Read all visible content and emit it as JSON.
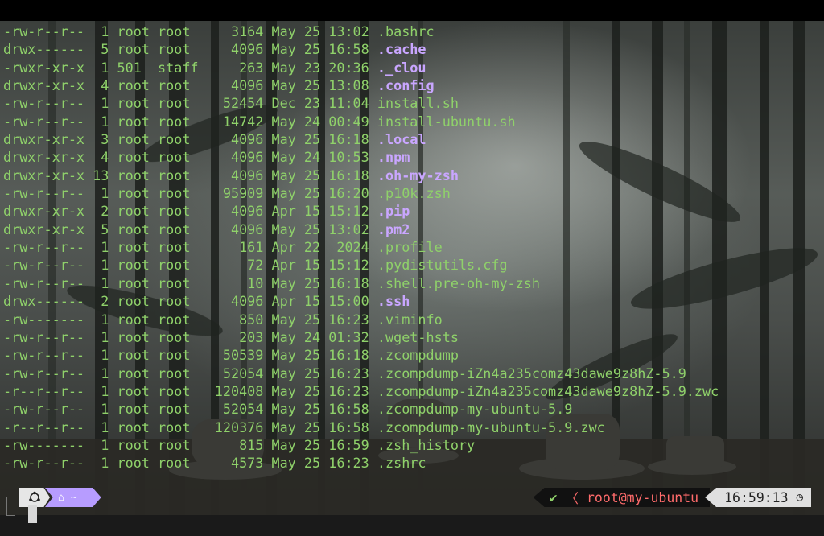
{
  "listing": [
    {
      "perm": "-rw-r--r--",
      "links": "1",
      "owner": "root",
      "group": "root",
      "size": "3164",
      "mon": "May",
      "day": "25",
      "time": "13:02",
      "name": ".bashrc",
      "kind": "plain"
    },
    {
      "perm": "drwx------",
      "links": "5",
      "owner": "root",
      "group": "root",
      "size": "4096",
      "mon": "May",
      "day": "25",
      "time": "16:58",
      "name": ".cache",
      "kind": "dir"
    },
    {
      "perm": "-rwxr-xr-x",
      "links": "1",
      "owner": "501",
      "group": "staff",
      "size": "263",
      "mon": "May",
      "day": "23",
      "time": "20:36",
      "name": "._clou",
      "kind": "dir"
    },
    {
      "perm": "drwxr-xr-x",
      "links": "4",
      "owner": "root",
      "group": "root",
      "size": "4096",
      "mon": "May",
      "day": "25",
      "time": "13:08",
      "name": ".config",
      "kind": "dir"
    },
    {
      "perm": "-rw-r--r--",
      "links": "1",
      "owner": "root",
      "group": "root",
      "size": "52454",
      "mon": "Dec",
      "day": "23",
      "time": "11:04",
      "name": "install.sh",
      "kind": "plain"
    },
    {
      "perm": "-rw-r--r--",
      "links": "1",
      "owner": "root",
      "group": "root",
      "size": "14742",
      "mon": "May",
      "day": "24",
      "time": "00:49",
      "name": "install-ubuntu.sh",
      "kind": "plain"
    },
    {
      "perm": "drwxr-xr-x",
      "links": "3",
      "owner": "root",
      "group": "root",
      "size": "4096",
      "mon": "May",
      "day": "25",
      "time": "16:18",
      "name": ".local",
      "kind": "dir"
    },
    {
      "perm": "drwxr-xr-x",
      "links": "4",
      "owner": "root",
      "group": "root",
      "size": "4096",
      "mon": "May",
      "day": "24",
      "time": "10:53",
      "name": ".npm",
      "kind": "dir"
    },
    {
      "perm": "drwxr-xr-x",
      "links": "13",
      "owner": "root",
      "group": "root",
      "size": "4096",
      "mon": "May",
      "day": "25",
      "time": "16:18",
      "name": ".oh-my-zsh",
      "kind": "dir"
    },
    {
      "perm": "-rw-r--r--",
      "links": "1",
      "owner": "root",
      "group": "root",
      "size": "95909",
      "mon": "May",
      "day": "25",
      "time": "16:20",
      "name": ".p10k.zsh",
      "kind": "plain"
    },
    {
      "perm": "drwxr-xr-x",
      "links": "2",
      "owner": "root",
      "group": "root",
      "size": "4096",
      "mon": "Apr",
      "day": "15",
      "time": "15:12",
      "name": ".pip",
      "kind": "dir"
    },
    {
      "perm": "drwxr-xr-x",
      "links": "5",
      "owner": "root",
      "group": "root",
      "size": "4096",
      "mon": "May",
      "day": "25",
      "time": "13:02",
      "name": ".pm2",
      "kind": "dir"
    },
    {
      "perm": "-rw-r--r--",
      "links": "1",
      "owner": "root",
      "group": "root",
      "size": "161",
      "mon": "Apr",
      "day": "22",
      "time": "2024",
      "name": ".profile",
      "kind": "plain"
    },
    {
      "perm": "-rw-r--r--",
      "links": "1",
      "owner": "root",
      "group": "root",
      "size": "72",
      "mon": "Apr",
      "day": "15",
      "time": "15:12",
      "name": ".pydistutils.cfg",
      "kind": "plain"
    },
    {
      "perm": "-rw-r--r--",
      "links": "1",
      "owner": "root",
      "group": "root",
      "size": "10",
      "mon": "May",
      "day": "25",
      "time": "16:18",
      "name": ".shell.pre-oh-my-zsh",
      "kind": "plain"
    },
    {
      "perm": "drwx------",
      "links": "2",
      "owner": "root",
      "group": "root",
      "size": "4096",
      "mon": "Apr",
      "day": "15",
      "time": "15:00",
      "name": ".ssh",
      "kind": "dir"
    },
    {
      "perm": "-rw-------",
      "links": "1",
      "owner": "root",
      "group": "root",
      "size": "850",
      "mon": "May",
      "day": "25",
      "time": "16:23",
      "name": ".viminfo",
      "kind": "plain"
    },
    {
      "perm": "-rw-r--r--",
      "links": "1",
      "owner": "root",
      "group": "root",
      "size": "203",
      "mon": "May",
      "day": "24",
      "time": "01:32",
      "name": ".wget-hsts",
      "kind": "plain"
    },
    {
      "perm": "-rw-r--r--",
      "links": "1",
      "owner": "root",
      "group": "root",
      "size": "50539",
      "mon": "May",
      "day": "25",
      "time": "16:18",
      "name": ".zcompdump",
      "kind": "plain"
    },
    {
      "perm": "-rw-r--r--",
      "links": "1",
      "owner": "root",
      "group": "root",
      "size": "52054",
      "mon": "May",
      "day": "25",
      "time": "16:23",
      "name": ".zcompdump-iZn4a235comz43dawe9z8hZ-5.9",
      "kind": "plain"
    },
    {
      "perm": "-r--r--r--",
      "links": "1",
      "owner": "root",
      "group": "root",
      "size": "120408",
      "mon": "May",
      "day": "25",
      "time": "16:23",
      "name": ".zcompdump-iZn4a235comz43dawe9z8hZ-5.9.zwc",
      "kind": "plain"
    },
    {
      "perm": "-rw-r--r--",
      "links": "1",
      "owner": "root",
      "group": "root",
      "size": "52054",
      "mon": "May",
      "day": "25",
      "time": "16:58",
      "name": ".zcompdump-my-ubuntu-5.9",
      "kind": "plain"
    },
    {
      "perm": "-r--r--r--",
      "links": "1",
      "owner": "root",
      "group": "root",
      "size": "120376",
      "mon": "May",
      "day": "25",
      "time": "16:58",
      "name": ".zcompdump-my-ubuntu-5.9.zwc",
      "kind": "plain"
    },
    {
      "perm": "-rw-------",
      "links": "1",
      "owner": "root",
      "group": "root",
      "size": "815",
      "mon": "May",
      "day": "25",
      "time": "16:59",
      "name": ".zsh_history",
      "kind": "plain"
    },
    {
      "perm": "-rw-r--r--",
      "links": "1",
      "owner": "root",
      "group": "root",
      "size": "4573",
      "mon": "May",
      "day": "25",
      "time": "16:23",
      "name": ".zshrc",
      "kind": "plain"
    }
  ],
  "prompt": {
    "os_icon": "ubuntu-icon",
    "home_icon": "home-icon",
    "dir": "~",
    "status_ok": "✔",
    "user_host": "root@my-ubuntu",
    "time": "16:59:13",
    "clock_icon": "clock-icon"
  },
  "colors": {
    "file": "#8fd16a",
    "dir": "#c9a6ff",
    "prompt_user": "#ff6b6b",
    "dir_segment": "#b79cff"
  }
}
